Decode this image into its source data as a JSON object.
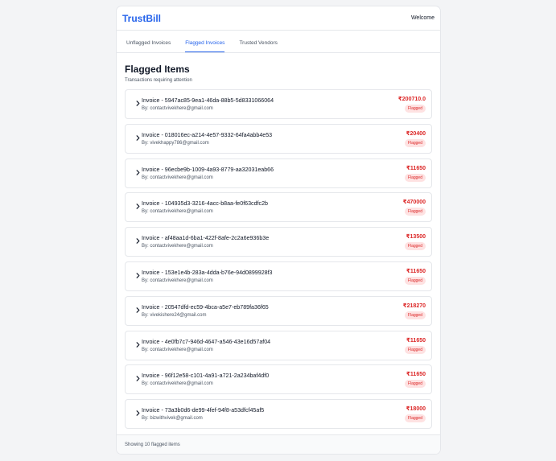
{
  "header": {
    "brand": "TrustBill",
    "welcome": "Welcome"
  },
  "tabs": [
    {
      "label": "Unflagged Invoices",
      "active": false
    },
    {
      "label": "Flagged Invoices",
      "active": true
    },
    {
      "label": "Trusted Vendors",
      "active": false
    }
  ],
  "main": {
    "title": "Flagged Items",
    "subtitle": "Transactions requiring attention"
  },
  "items": [
    {
      "title": "Invoice - 5947ac85-9ea1-46da-88b5-5d8331066064",
      "by": "By: contactvivekhere@gmail.com",
      "amount": "₹200710.0",
      "status": "Flagged"
    },
    {
      "title": "Invoice - 018016ec-a214-4e57-9332-64fa4abb4e53",
      "by": "By: vivekhappy786@gmail.com",
      "amount": "₹20400",
      "status": "Flagged"
    },
    {
      "title": "Invoice - 96ecbe9b-1009-4a93-8779-aa32031eab66",
      "by": "By: contactvivekhere@gmail.com",
      "amount": "₹11650",
      "status": "Flagged"
    },
    {
      "title": "Invoice - 104935d3-3216-4acc-b8aa-fe0f63cdfc2b",
      "by": "By: contactvivekhere@gmail.com",
      "amount": "₹470000",
      "status": "Flagged"
    },
    {
      "title": "Invoice - af48aa1d-6ba1-422f-8afe-2c2a6e936b3e",
      "by": "By: contactvivekhere@gmail.com",
      "amount": "₹13500",
      "status": "Flagged"
    },
    {
      "title": "Invoice - 153e1e4b-283a-4dda-b76e-94d0899928f3",
      "by": "By: contactvivekhere@gmail.com",
      "amount": "₹11650",
      "status": "Flagged"
    },
    {
      "title": "Invoice - 20547dfd-ec59-4bca-a5e7-eb789fa36f65",
      "by": "By: vivekishere24@gmail.com",
      "amount": "₹218270",
      "status": "Flagged"
    },
    {
      "title": "Invoice - 4e0fb7c7-946d-4647-a546-43e16d57af04",
      "by": "By: contactvivekhere@gmail.com",
      "amount": "₹11650",
      "status": "Flagged"
    },
    {
      "title": "Invoice - 96f12e58-c101-4a91-a721-2a234baf4df0",
      "by": "By: contactvivekhere@gmail.com",
      "amount": "₹11650",
      "status": "Flagged"
    },
    {
      "title": "Invoice - 73a3b0d6-de99-4fef-94f8-a53dfcf45af5",
      "by": "By: bizwithvivek@gmail.com",
      "amount": "₹18000",
      "status": "Flagged"
    }
  ],
  "icons": {
    "chevron": "chevron-right-icon"
  },
  "footer": {
    "text": "Showing 10 flagged items"
  },
  "colors": {
    "brand": "#2563eb",
    "amount": "#dc2626",
    "badge_bg": "#fee2e2"
  }
}
